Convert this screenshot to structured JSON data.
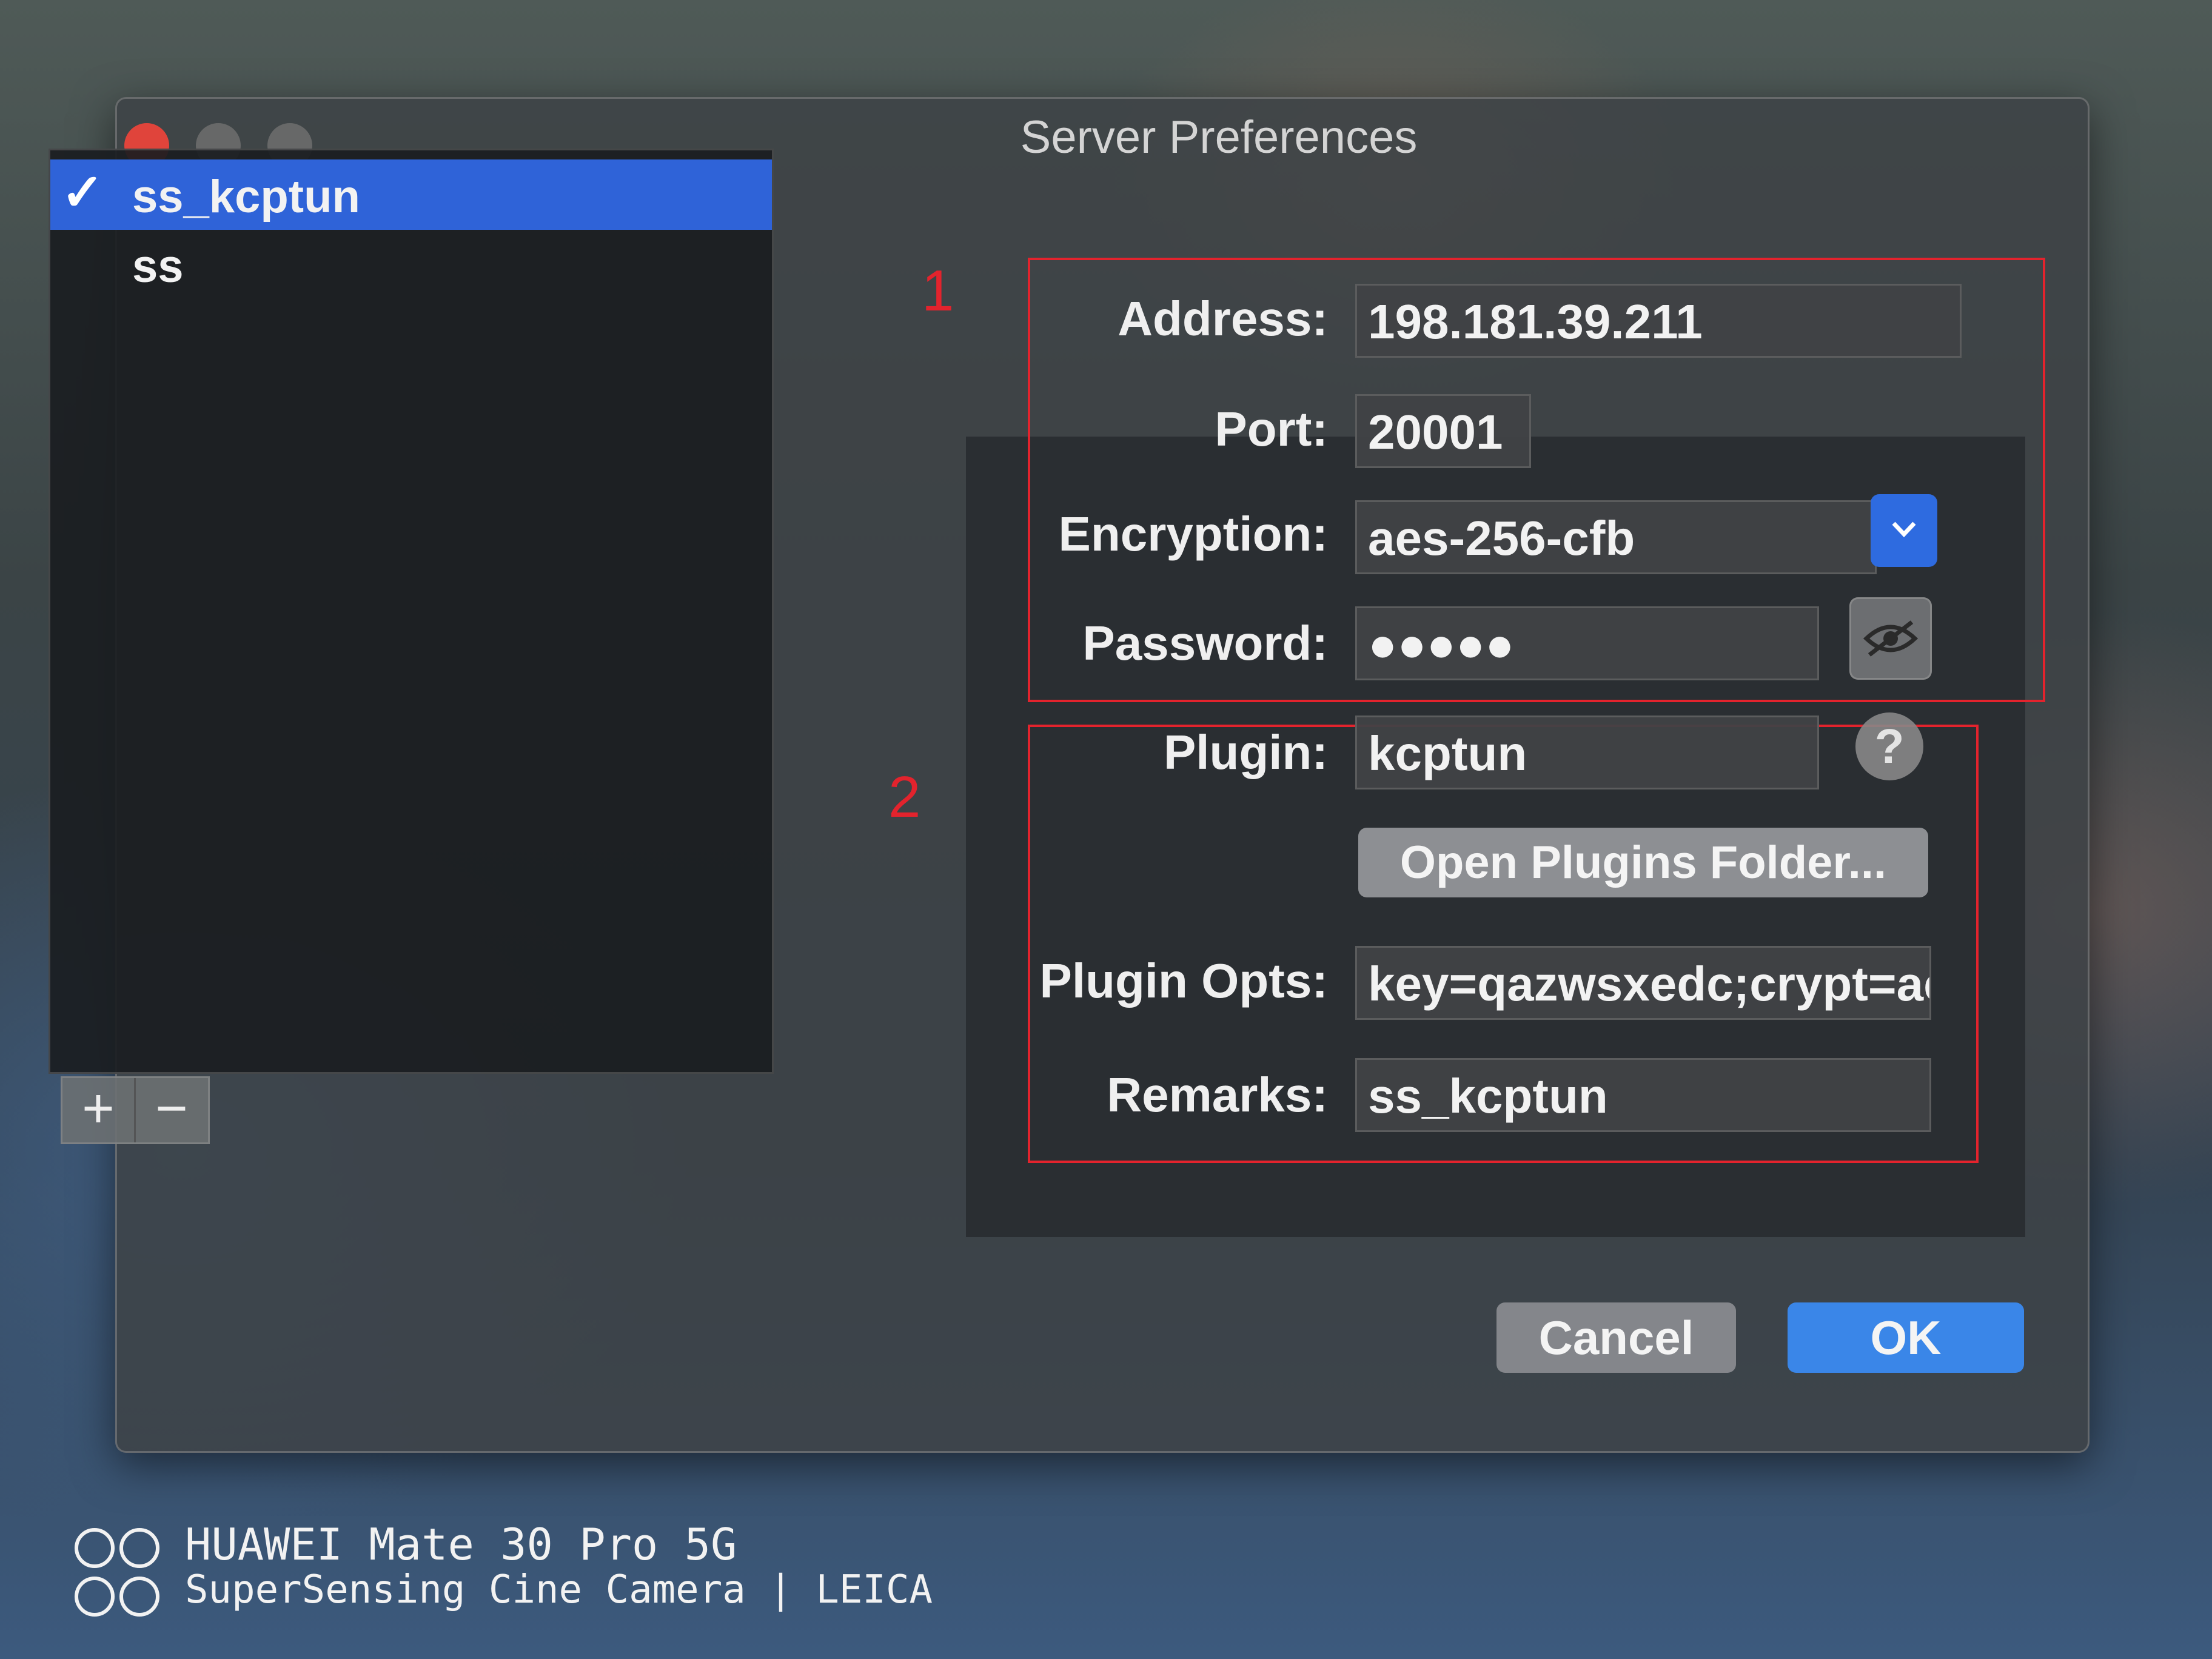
{
  "window": {
    "title": "Server Preferences"
  },
  "server_list": {
    "items": [
      {
        "label": "ss_kcptun",
        "selected": true
      },
      {
        "label": "ss",
        "selected": false
      }
    ],
    "add_label": "+",
    "remove_label": "−"
  },
  "annotations": {
    "box1_label": "1",
    "box2_label": "2",
    "color": "#e3232d"
  },
  "form": {
    "address_label": "Address:",
    "address_value": "198.181.39.211",
    "port_label": "Port:",
    "port_value": "20001",
    "encryption_label": "Encryption:",
    "encryption_value": "aes-256-cfb",
    "password_label": "Password:",
    "password_value": "●●●●●",
    "plugin_label": "Plugin:",
    "plugin_value": "kcptun",
    "open_plugins_label": "Open Plugins Folder...",
    "plugin_opts_label": "Plugin Opts:",
    "plugin_opts_value": "key=qazwsxedc;crypt=ae",
    "remarks_label": "Remarks:",
    "remarks_value": "ss_kcptun",
    "help_label": "?"
  },
  "footer": {
    "cancel_label": "Cancel",
    "ok_label": "OK"
  },
  "watermark": {
    "line1": "HUAWEI Mate 30 Pro 5G",
    "line2": "SuperSensing Cine Camera | LEICA"
  },
  "colors": {
    "accent": "#2f63d8",
    "close": "#e0443b"
  },
  "icons": {
    "checkmark": "checkmark-icon",
    "dropdown": "chevron-down-icon",
    "eye": "eye-slash-icon",
    "help": "help-icon"
  }
}
